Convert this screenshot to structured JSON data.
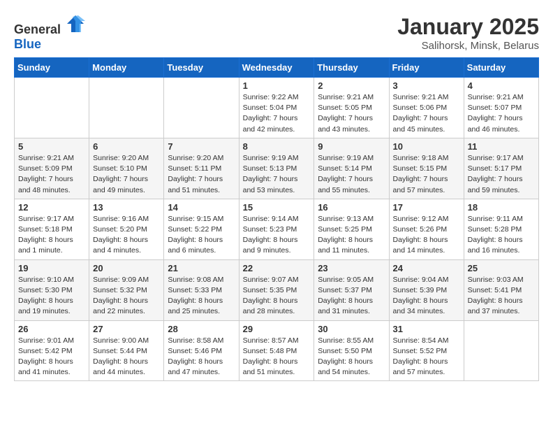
{
  "logo": {
    "general": "General",
    "blue": "Blue"
  },
  "title": "January 2025",
  "subtitle": "Salihorsk, Minsk, Belarus",
  "weekdays": [
    "Sunday",
    "Monday",
    "Tuesday",
    "Wednesday",
    "Thursday",
    "Friday",
    "Saturday"
  ],
  "weeks": [
    [
      {
        "day": "",
        "content": ""
      },
      {
        "day": "",
        "content": ""
      },
      {
        "day": "",
        "content": ""
      },
      {
        "day": "1",
        "content": "Sunrise: 9:22 AM\nSunset: 5:04 PM\nDaylight: 7 hours and 42 minutes."
      },
      {
        "day": "2",
        "content": "Sunrise: 9:21 AM\nSunset: 5:05 PM\nDaylight: 7 hours and 43 minutes."
      },
      {
        "day": "3",
        "content": "Sunrise: 9:21 AM\nSunset: 5:06 PM\nDaylight: 7 hours and 45 minutes."
      },
      {
        "day": "4",
        "content": "Sunrise: 9:21 AM\nSunset: 5:07 PM\nDaylight: 7 hours and 46 minutes."
      }
    ],
    [
      {
        "day": "5",
        "content": "Sunrise: 9:21 AM\nSunset: 5:09 PM\nDaylight: 7 hours and 48 minutes."
      },
      {
        "day": "6",
        "content": "Sunrise: 9:20 AM\nSunset: 5:10 PM\nDaylight: 7 hours and 49 minutes."
      },
      {
        "day": "7",
        "content": "Sunrise: 9:20 AM\nSunset: 5:11 PM\nDaylight: 7 hours and 51 minutes."
      },
      {
        "day": "8",
        "content": "Sunrise: 9:19 AM\nSunset: 5:13 PM\nDaylight: 7 hours and 53 minutes."
      },
      {
        "day": "9",
        "content": "Sunrise: 9:19 AM\nSunset: 5:14 PM\nDaylight: 7 hours and 55 minutes."
      },
      {
        "day": "10",
        "content": "Sunrise: 9:18 AM\nSunset: 5:15 PM\nDaylight: 7 hours and 57 minutes."
      },
      {
        "day": "11",
        "content": "Sunrise: 9:17 AM\nSunset: 5:17 PM\nDaylight: 7 hours and 59 minutes."
      }
    ],
    [
      {
        "day": "12",
        "content": "Sunrise: 9:17 AM\nSunset: 5:18 PM\nDaylight: 8 hours and 1 minute."
      },
      {
        "day": "13",
        "content": "Sunrise: 9:16 AM\nSunset: 5:20 PM\nDaylight: 8 hours and 4 minutes."
      },
      {
        "day": "14",
        "content": "Sunrise: 9:15 AM\nSunset: 5:22 PM\nDaylight: 8 hours and 6 minutes."
      },
      {
        "day": "15",
        "content": "Sunrise: 9:14 AM\nSunset: 5:23 PM\nDaylight: 8 hours and 9 minutes."
      },
      {
        "day": "16",
        "content": "Sunrise: 9:13 AM\nSunset: 5:25 PM\nDaylight: 8 hours and 11 minutes."
      },
      {
        "day": "17",
        "content": "Sunrise: 9:12 AM\nSunset: 5:26 PM\nDaylight: 8 hours and 14 minutes."
      },
      {
        "day": "18",
        "content": "Sunrise: 9:11 AM\nSunset: 5:28 PM\nDaylight: 8 hours and 16 minutes."
      }
    ],
    [
      {
        "day": "19",
        "content": "Sunrise: 9:10 AM\nSunset: 5:30 PM\nDaylight: 8 hours and 19 minutes."
      },
      {
        "day": "20",
        "content": "Sunrise: 9:09 AM\nSunset: 5:32 PM\nDaylight: 8 hours and 22 minutes."
      },
      {
        "day": "21",
        "content": "Sunrise: 9:08 AM\nSunset: 5:33 PM\nDaylight: 8 hours and 25 minutes."
      },
      {
        "day": "22",
        "content": "Sunrise: 9:07 AM\nSunset: 5:35 PM\nDaylight: 8 hours and 28 minutes."
      },
      {
        "day": "23",
        "content": "Sunrise: 9:05 AM\nSunset: 5:37 PM\nDaylight: 8 hours and 31 minutes."
      },
      {
        "day": "24",
        "content": "Sunrise: 9:04 AM\nSunset: 5:39 PM\nDaylight: 8 hours and 34 minutes."
      },
      {
        "day": "25",
        "content": "Sunrise: 9:03 AM\nSunset: 5:41 PM\nDaylight: 8 hours and 37 minutes."
      }
    ],
    [
      {
        "day": "26",
        "content": "Sunrise: 9:01 AM\nSunset: 5:42 PM\nDaylight: 8 hours and 41 minutes."
      },
      {
        "day": "27",
        "content": "Sunrise: 9:00 AM\nSunset: 5:44 PM\nDaylight: 8 hours and 44 minutes."
      },
      {
        "day": "28",
        "content": "Sunrise: 8:58 AM\nSunset: 5:46 PM\nDaylight: 8 hours and 47 minutes."
      },
      {
        "day": "29",
        "content": "Sunrise: 8:57 AM\nSunset: 5:48 PM\nDaylight: 8 hours and 51 minutes."
      },
      {
        "day": "30",
        "content": "Sunrise: 8:55 AM\nSunset: 5:50 PM\nDaylight: 8 hours and 54 minutes."
      },
      {
        "day": "31",
        "content": "Sunrise: 8:54 AM\nSunset: 5:52 PM\nDaylight: 8 hours and 57 minutes."
      },
      {
        "day": "",
        "content": ""
      }
    ]
  ]
}
